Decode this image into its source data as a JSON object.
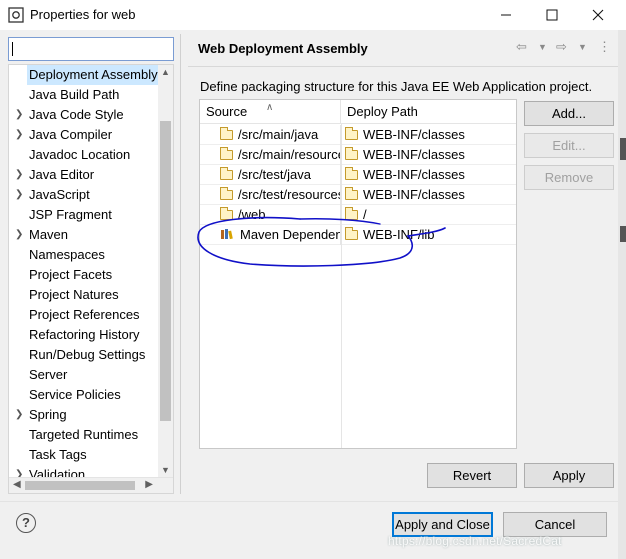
{
  "window": {
    "title": "Properties for web",
    "icon": "eclipse-icon",
    "controls": [
      "minimize-icon",
      "maximize-icon",
      "close-icon"
    ]
  },
  "filter": {
    "value": "",
    "placeholder": ""
  },
  "nav": {
    "items": [
      {
        "label": "Deployment Assembly",
        "expandable": false,
        "selected": true
      },
      {
        "label": "Java Build Path",
        "expandable": false
      },
      {
        "label": "Java Code Style",
        "expandable": true
      },
      {
        "label": "Java Compiler",
        "expandable": true
      },
      {
        "label": "Javadoc Location",
        "expandable": false
      },
      {
        "label": "Java Editor",
        "expandable": true
      },
      {
        "label": "JavaScript",
        "expandable": true
      },
      {
        "label": "JSP Fragment",
        "expandable": false
      },
      {
        "label": "Maven",
        "expandable": true
      },
      {
        "label": "Namespaces",
        "expandable": false
      },
      {
        "label": "Project Facets",
        "expandable": false
      },
      {
        "label": "Project Natures",
        "expandable": false
      },
      {
        "label": "Project References",
        "expandable": false
      },
      {
        "label": "Refactoring History",
        "expandable": false
      },
      {
        "label": "Run/Debug Settings",
        "expandable": false
      },
      {
        "label": "Server",
        "expandable": false
      },
      {
        "label": "Service Policies",
        "expandable": false
      },
      {
        "label": "Spring",
        "expandable": true
      },
      {
        "label": "Targeted Runtimes",
        "expandable": false
      },
      {
        "label": "Task Tags",
        "expandable": false
      },
      {
        "label": "Validation",
        "expandable": true
      }
    ]
  },
  "page": {
    "title": "Web Deployment Assembly",
    "description": "Define packaging structure for this Java EE Web Application project.",
    "toolbar": [
      "back-icon",
      "back-menu-icon",
      "forward-icon",
      "forward-menu-icon",
      "view-menu-icon"
    ]
  },
  "table": {
    "columns": [
      "Source",
      "Deploy Path"
    ],
    "rows": [
      {
        "source": "/src/main/java",
        "deploy": "WEB-INF/classes",
        "icon": "folder-icon"
      },
      {
        "source": "/src/main/resources",
        "deploy": "WEB-INF/classes",
        "icon": "folder-icon"
      },
      {
        "source": "/src/test/java",
        "deploy": "WEB-INF/classes",
        "icon": "folder-icon"
      },
      {
        "source": "/src/test/resources",
        "deploy": "WEB-INF/classes",
        "icon": "folder-icon"
      },
      {
        "source": "/web",
        "deploy": "/",
        "icon": "folder-icon"
      },
      {
        "source": "Maven Dependencies",
        "deploy": "WEB-INF/lib",
        "icon": "library-icon"
      }
    ]
  },
  "side_buttons": {
    "add": "Add...",
    "edit": "Edit...",
    "remove": "Remove"
  },
  "page_buttons": {
    "revert": "Revert",
    "apply": "Apply"
  },
  "dialog_buttons": {
    "apply_close": "Apply and Close",
    "cancel": "Cancel",
    "help": "?"
  },
  "watermark": "https://blog.csdn.net/SacredCat",
  "colors": {
    "selection": "#cce8ff",
    "annotation_ink": "#1010c8",
    "default_button_border": "#0078d7"
  }
}
